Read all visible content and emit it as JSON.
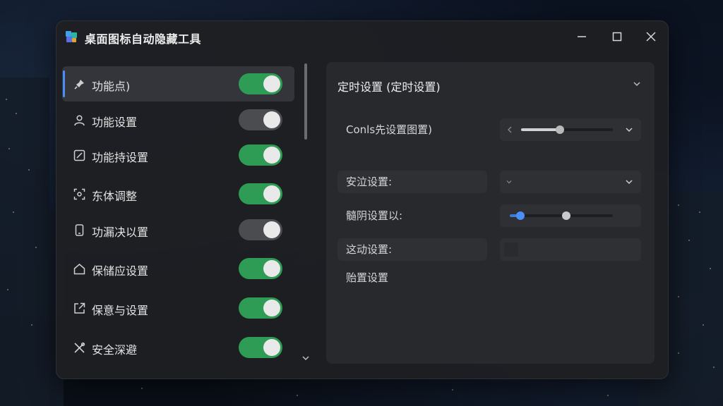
{
  "app": {
    "title": "桌面图标自动隐藏工具"
  },
  "window_controls": {
    "minimize": "minimize",
    "maximize": "maximize",
    "close": "close"
  },
  "sidebar": {
    "items": [
      {
        "label": "功能点)",
        "icon": "pin-icon",
        "enabled": true,
        "active": true
      },
      {
        "label": "功能设置",
        "icon": "user-icon",
        "enabled": false,
        "active": false
      },
      {
        "label": "功能持设置",
        "icon": "edit-box-icon",
        "enabled": true,
        "active": false
      },
      {
        "label": "东体调整",
        "icon": "scan-icon",
        "enabled": true,
        "active": false
      },
      {
        "label": "功漏决以置",
        "icon": "phone-icon",
        "enabled": false,
        "active": false
      },
      {
        "label": "保储应设置",
        "icon": "home-icon",
        "enabled": true,
        "active": false
      },
      {
        "label": "保意与设置",
        "icon": "external-link-icon",
        "enabled": true,
        "active": false
      },
      {
        "label": "安全深避",
        "icon": "tools-icon",
        "enabled": true,
        "active": false
      }
    ]
  },
  "detail": {
    "section_title": "定时设置 (定时设置)",
    "rows": [
      {
        "label": "Conls先设置图置)",
        "control": "slider-dropdown",
        "value": 0.42
      },
      {
        "label": "安泣设置:",
        "control": "dropdown",
        "value": ""
      },
      {
        "label": "髓阴设置以:",
        "control": "range",
        "low": 0.1,
        "high": 0.55
      },
      {
        "label": "这动设置:",
        "control": "box",
        "value": ""
      },
      {
        "label": "贻置设置",
        "control": "none"
      }
    ]
  },
  "colors": {
    "toggle_on": "#2f9c55",
    "toggle_off": "#4b4c50",
    "accent": "#4c8ef7"
  }
}
